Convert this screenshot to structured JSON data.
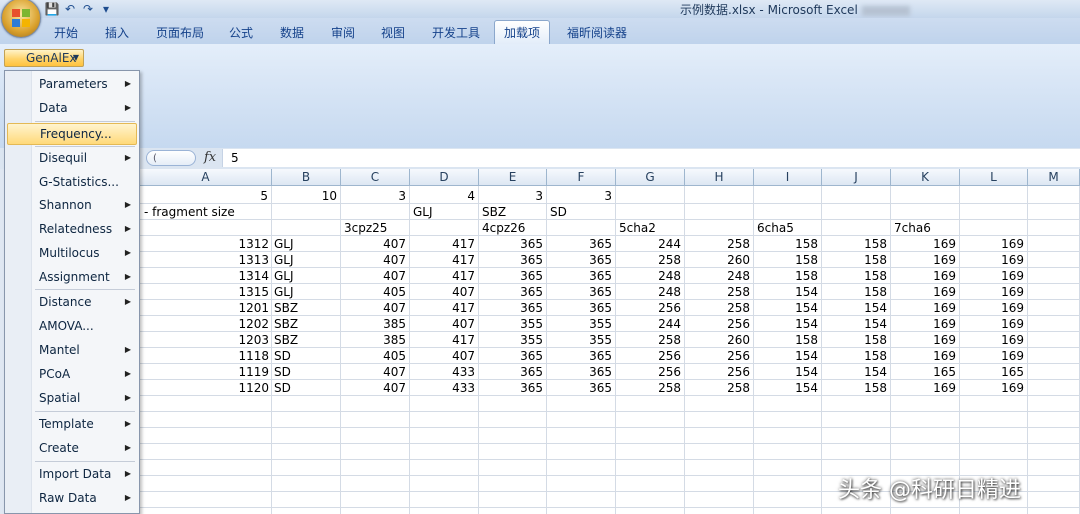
{
  "window": {
    "title": "示例数据.xlsx - Microsoft Excel"
  },
  "ribbon_tabs": [
    "开始",
    "插入",
    "页面布局",
    "公式",
    "数据",
    "审阅",
    "视图",
    "开发工具",
    "加载项",
    "福昕阅读器"
  ],
  "active_tab": "加载项",
  "addin": {
    "button_label": "GenAlEx"
  },
  "menu": {
    "items": [
      {
        "label": "Parameters",
        "submenu": true
      },
      {
        "label": "Data",
        "submenu": true
      },
      {
        "label": "Frequency...",
        "submenu": false,
        "highlighted": true
      },
      {
        "label": "Disequil",
        "submenu": true
      },
      {
        "label": "G-Statistics...",
        "submenu": false
      },
      {
        "label": "Shannon",
        "submenu": true
      },
      {
        "label": "Relatedness",
        "submenu": true
      },
      {
        "label": "Multilocus",
        "submenu": true
      },
      {
        "label": "Assignment",
        "submenu": true
      },
      {
        "label": "Distance",
        "submenu": true
      },
      {
        "label": "AMOVA...",
        "submenu": false
      },
      {
        "label": "Mantel",
        "submenu": true
      },
      {
        "label": "PCoA",
        "submenu": true
      },
      {
        "label": "Spatial",
        "submenu": true
      },
      {
        "label": "Template",
        "submenu": true
      },
      {
        "label": "Create",
        "submenu": true
      },
      {
        "label": "Import Data",
        "submenu": true
      },
      {
        "label": "Raw Data",
        "submenu": true
      }
    ]
  },
  "formula_bar": {
    "fx": "fx",
    "value": "5"
  },
  "sheet": {
    "columns": [
      "A",
      "B",
      "C",
      "D",
      "E",
      "F",
      "G",
      "H",
      "I",
      "J",
      "K",
      "L",
      "M"
    ],
    "header_row_1": [
      "5",
      "10",
      "3",
      "4",
      "3",
      "3"
    ],
    "header_row_2": {
      "a": "- fragment size",
      "d": "GLJ",
      "e": "SBZ",
      "f": "SD"
    },
    "header_row_3": {
      "c": "3cpz25",
      "e": "4cpz26",
      "g": "5cha2",
      "i": "6cha5",
      "k": "7cha6"
    },
    "rows": [
      {
        "id": "1312",
        "pop": "GLJ",
        "v": [
          "407",
          "417",
          "365",
          "365",
          "244",
          "258",
          "158",
          "158",
          "169",
          "169"
        ]
      },
      {
        "id": "1313",
        "pop": "GLJ",
        "v": [
          "407",
          "417",
          "365",
          "365",
          "258",
          "260",
          "158",
          "158",
          "169",
          "169"
        ]
      },
      {
        "id": "1314",
        "pop": "GLJ",
        "v": [
          "407",
          "417",
          "365",
          "365",
          "248",
          "248",
          "158",
          "158",
          "169",
          "169"
        ]
      },
      {
        "id": "1315",
        "pop": "GLJ",
        "v": [
          "405",
          "407",
          "365",
          "365",
          "248",
          "258",
          "154",
          "158",
          "169",
          "169"
        ]
      },
      {
        "id": "1201",
        "pop": "SBZ",
        "v": [
          "407",
          "417",
          "365",
          "365",
          "256",
          "258",
          "154",
          "154",
          "169",
          "169"
        ]
      },
      {
        "id": "1202",
        "pop": "SBZ",
        "v": [
          "385",
          "407",
          "355",
          "355",
          "244",
          "256",
          "154",
          "154",
          "169",
          "169"
        ]
      },
      {
        "id": "1203",
        "pop": "SBZ",
        "v": [
          "385",
          "417",
          "355",
          "355",
          "258",
          "260",
          "158",
          "158",
          "169",
          "169"
        ]
      },
      {
        "id": "1118",
        "pop": "SD",
        "v": [
          "405",
          "407",
          "365",
          "365",
          "256",
          "256",
          "154",
          "158",
          "169",
          "169"
        ]
      },
      {
        "id": "1119",
        "pop": "SD",
        "v": [
          "407",
          "433",
          "365",
          "365",
          "256",
          "256",
          "154",
          "154",
          "165",
          "165"
        ]
      },
      {
        "id": "1120",
        "pop": "SD",
        "v": [
          "407",
          "433",
          "365",
          "365",
          "258",
          "258",
          "154",
          "158",
          "169",
          "169"
        ]
      }
    ]
  },
  "watermark": "头条 @科研日精进"
}
